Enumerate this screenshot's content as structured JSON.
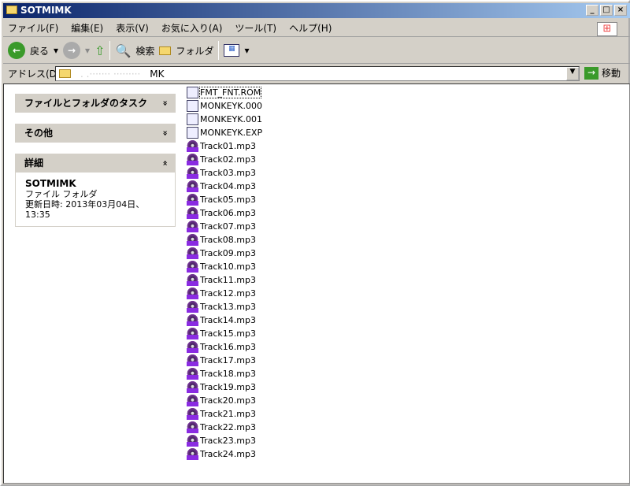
{
  "window": {
    "title": "SOTMIMK",
    "buttons": [
      "_",
      "□",
      "×"
    ]
  },
  "menu": [
    "ファイル(F)",
    "編集(E)",
    "表示(V)",
    "お気に入り(A)",
    "ツール(T)",
    "ヘルプ(H)"
  ],
  "toolbar": {
    "back": "戻る",
    "search": "検索",
    "folders": "フォルダ"
  },
  "address": {
    "label": "アドレス(D)",
    "value": "MK",
    "go": "移動"
  },
  "panels": [
    {
      "title": "ファイルとフォルダのタスク",
      "chevron": "»"
    },
    {
      "title": "その他",
      "chevron": "»"
    },
    {
      "title": "詳細",
      "chevron": "«",
      "name": "SOTMIMK",
      "type": "ファイル フォルダ",
      "modified": "更新日時: 2013年03月04日、13:35"
    }
  ],
  "files": [
    {
      "name": "FMT_FNT.ROM",
      "icon": "rom-icon"
    },
    {
      "name": "MONKEYK.000",
      "icon": "file-icon"
    },
    {
      "name": "MONKEYK.001",
      "icon": "file-icon"
    },
    {
      "name": "MONKEYK.EXP",
      "icon": "rom-icon"
    },
    {
      "name": "Track01.mp3",
      "icon": "mp3-icon"
    },
    {
      "name": "Track02.mp3",
      "icon": "mp3-icon"
    },
    {
      "name": "Track03.mp3",
      "icon": "mp3-icon"
    },
    {
      "name": "Track04.mp3",
      "icon": "mp3-icon"
    },
    {
      "name": "Track05.mp3",
      "icon": "mp3-icon"
    },
    {
      "name": "Track06.mp3",
      "icon": "mp3-icon"
    },
    {
      "name": "Track07.mp3",
      "icon": "mp3-icon"
    },
    {
      "name": "Track08.mp3",
      "icon": "mp3-icon"
    },
    {
      "name": "Track09.mp3",
      "icon": "mp3-icon"
    },
    {
      "name": "Track10.mp3",
      "icon": "mp3-icon"
    },
    {
      "name": "Track11.mp3",
      "icon": "mp3-icon"
    },
    {
      "name": "Track12.mp3",
      "icon": "mp3-icon"
    },
    {
      "name": "Track13.mp3",
      "icon": "mp3-icon"
    },
    {
      "name": "Track14.mp3",
      "icon": "mp3-icon"
    },
    {
      "name": "Track15.mp3",
      "icon": "mp3-icon"
    },
    {
      "name": "Track16.mp3",
      "icon": "mp3-icon"
    },
    {
      "name": "Track17.mp3",
      "icon": "mp3-icon"
    },
    {
      "name": "Track18.mp3",
      "icon": "mp3-icon"
    },
    {
      "name": "Track19.mp3",
      "icon": "mp3-icon"
    },
    {
      "name": "Track20.mp3",
      "icon": "mp3-icon"
    },
    {
      "name": "Track21.mp3",
      "icon": "mp3-icon"
    },
    {
      "name": "Track22.mp3",
      "icon": "mp3-icon"
    },
    {
      "name": "Track23.mp3",
      "icon": "mp3-icon"
    },
    {
      "name": "Track24.mp3",
      "icon": "mp3-icon"
    }
  ]
}
